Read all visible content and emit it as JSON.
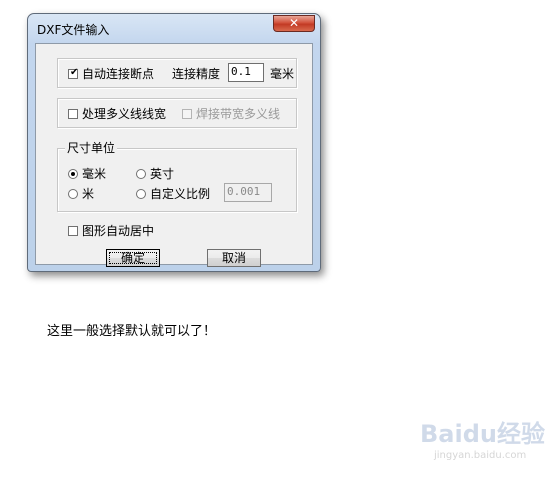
{
  "dialog": {
    "title": "DXF文件输入",
    "close_symbol": "✕"
  },
  "connect_group": {
    "auto_connect_label": "自动连接断点",
    "auto_connect_checked": true,
    "precision_label": "连接精度",
    "precision_value": "0.1",
    "unit_label": "毫米"
  },
  "polyline_group": {
    "process_width_label": "处理多义线线宽",
    "process_width_checked": false,
    "weld_width_label": "焊接带宽多义线",
    "weld_width_checked": false
  },
  "unit_group": {
    "legend": "尺寸单位",
    "options": [
      "毫米",
      "英寸",
      "米",
      "自定义比例"
    ],
    "selected": "毫米",
    "custom_scale_value": "0.001"
  },
  "auto_center": {
    "label": "图形自动居中",
    "checked": false
  },
  "buttons": {
    "ok_label": "确定",
    "cancel_label": "取消"
  },
  "caption": "这里一般选择默认就可以了！",
  "watermark": {
    "brand": "Baidu经验",
    "url": "jingyan.baidu.com"
  }
}
